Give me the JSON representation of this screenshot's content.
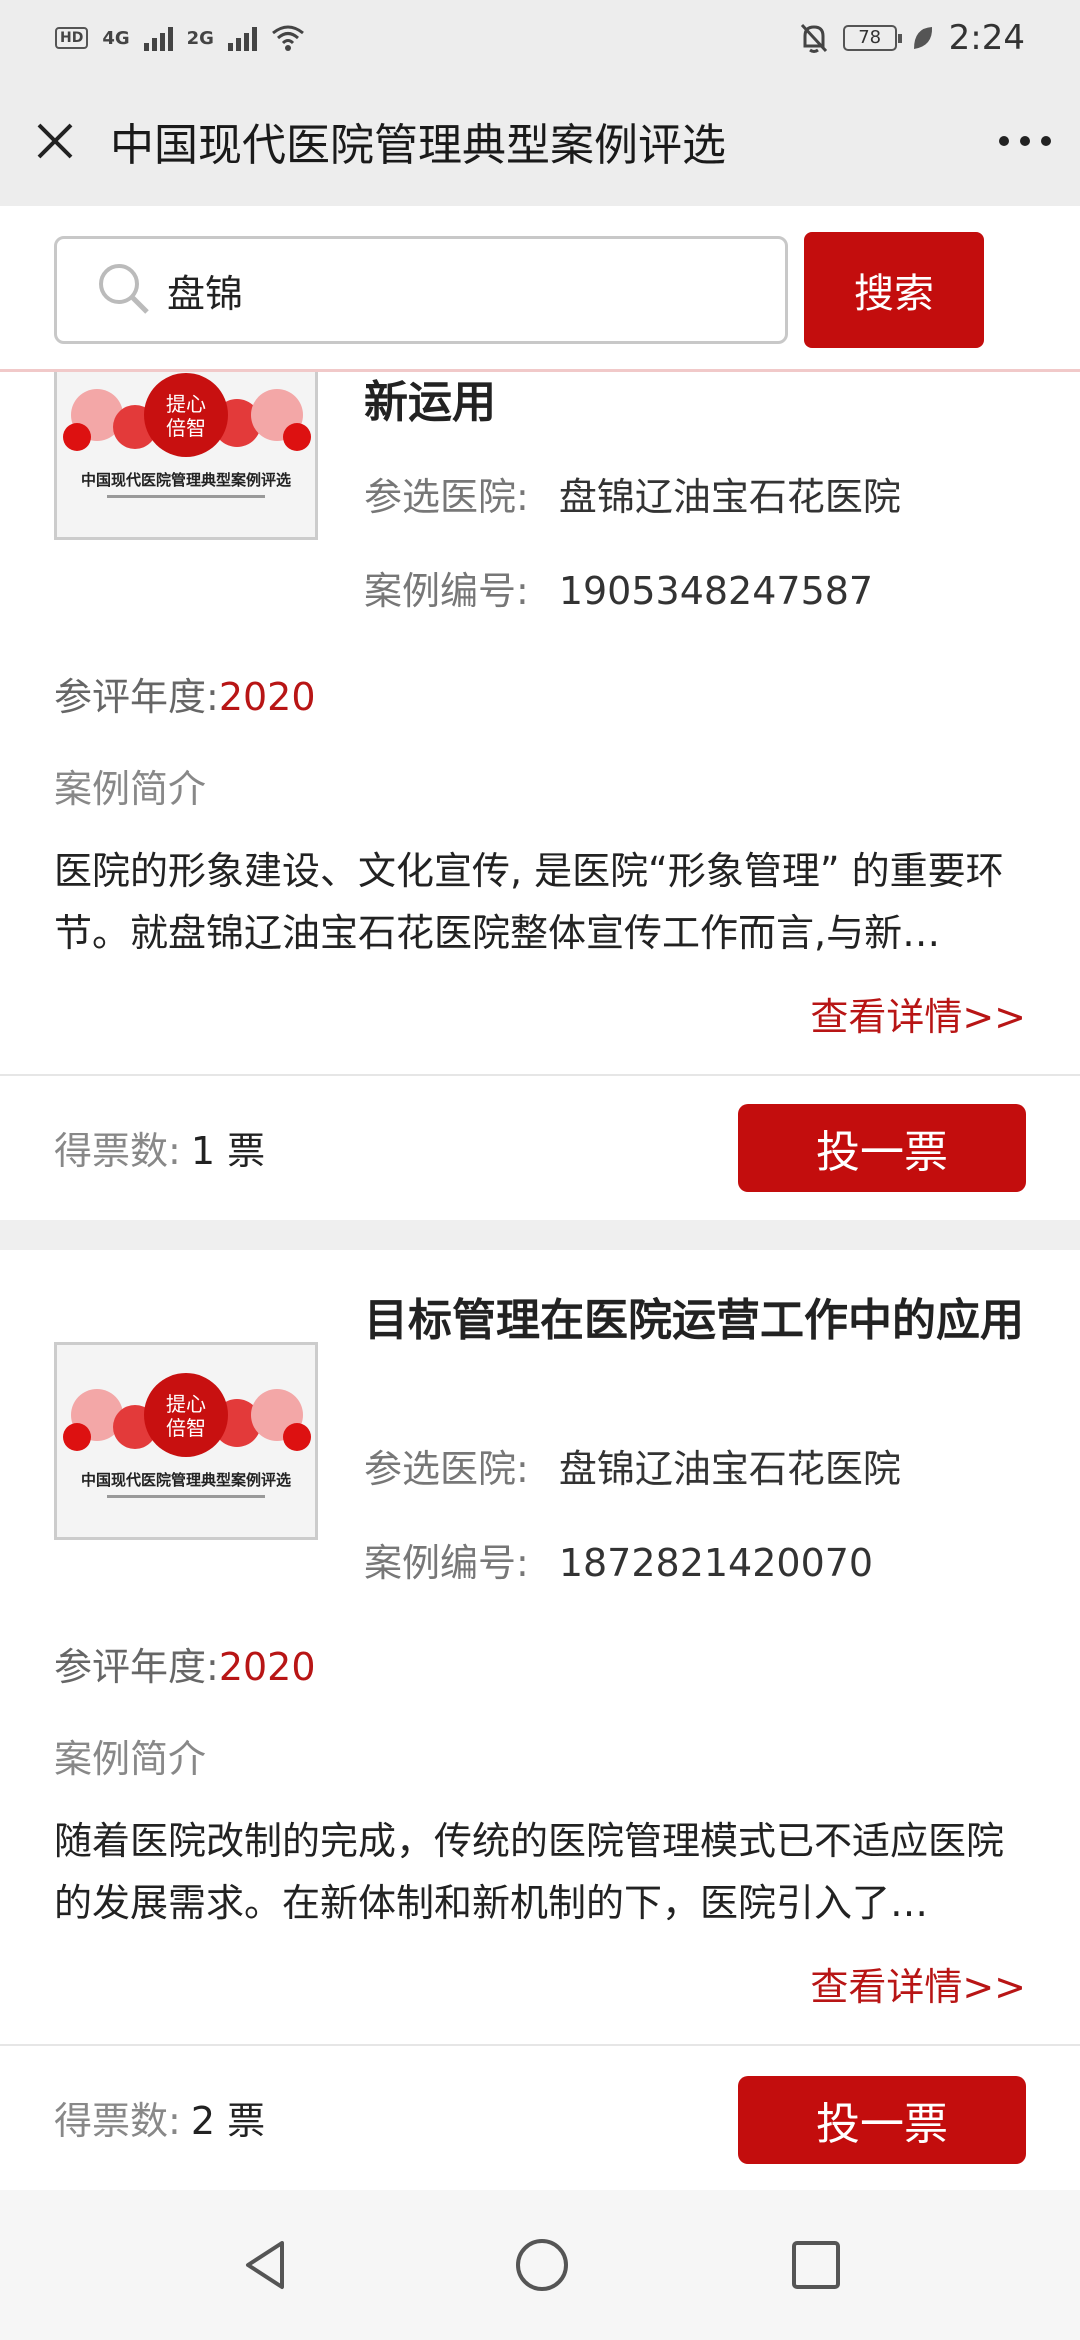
{
  "status_bar": {
    "hd_badge": "HD",
    "net1": "4G",
    "net2": "2G",
    "battery": "78",
    "time": "2:24"
  },
  "header": {
    "title": "中国现代医院管理典型案例评选"
  },
  "search": {
    "value": "盘锦",
    "button_label": "搜索"
  },
  "cards": [
    {
      "title": "新运用",
      "hospital_label": "参选医院:",
      "hospital": "盘锦辽油宝石花医院",
      "number_label": "案例编号:",
      "number": "1905348247587",
      "year_label": "参评年度:",
      "year": "2020",
      "intro_label": "案例简介",
      "intro": "医院的形象建设、文化宣传, 是医院“形象管理” 的重要环节。就盘锦辽油宝石花医院整体宣传工作而言,与新…",
      "detail_link": "查看详情>>",
      "votes_label": "得票数:",
      "votes": "1 票",
      "vote_button": "投一票"
    },
    {
      "title": "目标管理在医院运营工作中的应用",
      "hospital_label": "参选医院:",
      "hospital": "盘锦辽油宝石花医院",
      "number_label": "案例编号:",
      "number": "1872821420070",
      "year_label": "参评年度:",
      "year": "2020",
      "intro_label": "案例简介",
      "intro": "随着医院改制的完成，传统的医院管理模式已不适应医院的发展需求。在新体制和新机制的下，医院引入了…",
      "detail_link": "查看详情>>",
      "votes_label": "得票数:",
      "votes": "2 票",
      "vote_button": "投一票"
    }
  ],
  "thumbnail": {
    "caption": "中国现代医院管理典型案例评选",
    "seal_line1": "提心",
    "seal_line2": "倍智"
  },
  "colors": {
    "accent": "#c30d0d",
    "link": "#b81515"
  }
}
